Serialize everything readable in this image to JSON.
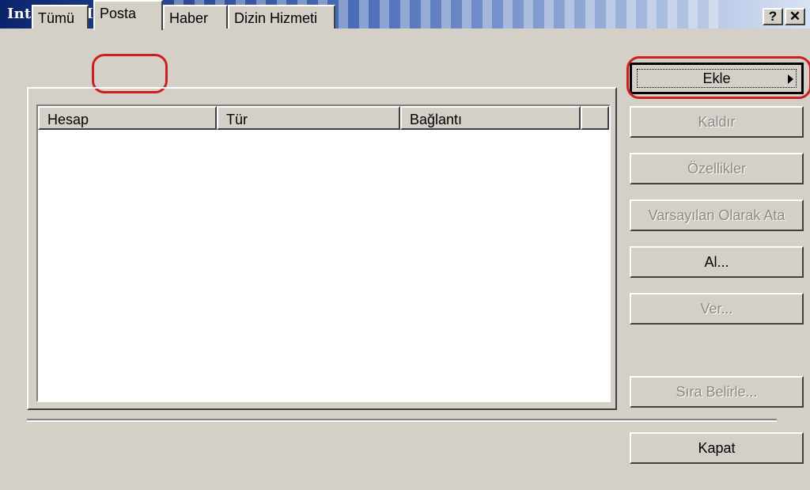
{
  "window": {
    "title": "Internet Hesapları",
    "help_btn": "?",
    "close_btn": "✕"
  },
  "tabs": [
    {
      "label": "Tümü"
    },
    {
      "label": "Posta",
      "selected": true
    },
    {
      "label": "Haber"
    },
    {
      "label": "Dizin Hizmeti"
    }
  ],
  "list": {
    "columns": [
      "Hesap",
      "Tür",
      "Bağlantı"
    ],
    "rows": []
  },
  "buttons": {
    "add": {
      "label": "Ekle",
      "enabled": true,
      "has_submenu": true
    },
    "remove": {
      "label": "Kaldır",
      "enabled": false
    },
    "properties": {
      "label": "Özellikler",
      "enabled": false
    },
    "set_default": {
      "label": "Varsayılan Olarak Ata",
      "enabled": false
    },
    "import": {
      "label": "Al...",
      "enabled": true
    },
    "export": {
      "label": "Ver...",
      "enabled": false
    },
    "set_order": {
      "label": "Sıra Belirle...",
      "enabled": false
    },
    "close": {
      "label": "Kapat",
      "enabled": true
    }
  },
  "colors": {
    "highlight_circle": "#cc2020",
    "titlebar_start": "#0a246a",
    "dialog_bg": "#d4d0c8"
  }
}
